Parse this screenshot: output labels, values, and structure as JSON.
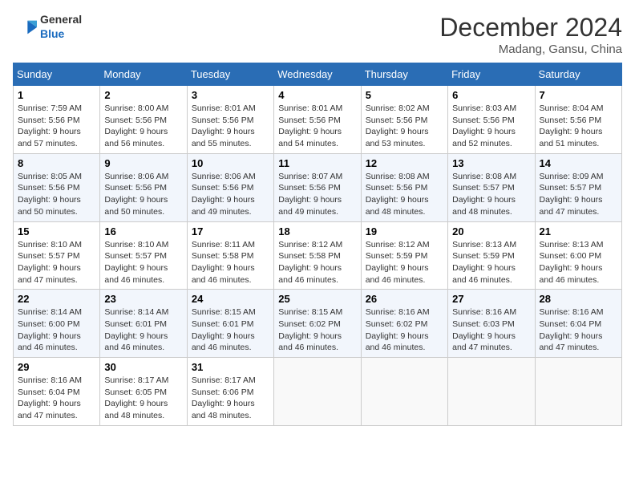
{
  "header": {
    "logo_general": "General",
    "logo_blue": "Blue",
    "title": "December 2024",
    "location": "Madang, Gansu, China"
  },
  "weekdays": [
    "Sunday",
    "Monday",
    "Tuesday",
    "Wednesday",
    "Thursday",
    "Friday",
    "Saturday"
  ],
  "weeks": [
    [
      {
        "day": "1",
        "sunrise": "7:59 AM",
        "sunset": "5:56 PM",
        "daylight": "9 hours and 57 minutes."
      },
      {
        "day": "2",
        "sunrise": "8:00 AM",
        "sunset": "5:56 PM",
        "daylight": "9 hours and 56 minutes."
      },
      {
        "day": "3",
        "sunrise": "8:01 AM",
        "sunset": "5:56 PM",
        "daylight": "9 hours and 55 minutes."
      },
      {
        "day": "4",
        "sunrise": "8:01 AM",
        "sunset": "5:56 PM",
        "daylight": "9 hours and 54 minutes."
      },
      {
        "day": "5",
        "sunrise": "8:02 AM",
        "sunset": "5:56 PM",
        "daylight": "9 hours and 53 minutes."
      },
      {
        "day": "6",
        "sunrise": "8:03 AM",
        "sunset": "5:56 PM",
        "daylight": "9 hours and 52 minutes."
      },
      {
        "day": "7",
        "sunrise": "8:04 AM",
        "sunset": "5:56 PM",
        "daylight": "9 hours and 51 minutes."
      }
    ],
    [
      {
        "day": "8",
        "sunrise": "8:05 AM",
        "sunset": "5:56 PM",
        "daylight": "9 hours and 50 minutes."
      },
      {
        "day": "9",
        "sunrise": "8:06 AM",
        "sunset": "5:56 PM",
        "daylight": "9 hours and 50 minutes."
      },
      {
        "day": "10",
        "sunrise": "8:06 AM",
        "sunset": "5:56 PM",
        "daylight": "9 hours and 49 minutes."
      },
      {
        "day": "11",
        "sunrise": "8:07 AM",
        "sunset": "5:56 PM",
        "daylight": "9 hours and 49 minutes."
      },
      {
        "day": "12",
        "sunrise": "8:08 AM",
        "sunset": "5:56 PM",
        "daylight": "9 hours and 48 minutes."
      },
      {
        "day": "13",
        "sunrise": "8:08 AM",
        "sunset": "5:57 PM",
        "daylight": "9 hours and 48 minutes."
      },
      {
        "day": "14",
        "sunrise": "8:09 AM",
        "sunset": "5:57 PM",
        "daylight": "9 hours and 47 minutes."
      }
    ],
    [
      {
        "day": "15",
        "sunrise": "8:10 AM",
        "sunset": "5:57 PM",
        "daylight": "9 hours and 47 minutes."
      },
      {
        "day": "16",
        "sunrise": "8:10 AM",
        "sunset": "5:57 PM",
        "daylight": "9 hours and 46 minutes."
      },
      {
        "day": "17",
        "sunrise": "8:11 AM",
        "sunset": "5:58 PM",
        "daylight": "9 hours and 46 minutes."
      },
      {
        "day": "18",
        "sunrise": "8:12 AM",
        "sunset": "5:58 PM",
        "daylight": "9 hours and 46 minutes."
      },
      {
        "day": "19",
        "sunrise": "8:12 AM",
        "sunset": "5:59 PM",
        "daylight": "9 hours and 46 minutes."
      },
      {
        "day": "20",
        "sunrise": "8:13 AM",
        "sunset": "5:59 PM",
        "daylight": "9 hours and 46 minutes."
      },
      {
        "day": "21",
        "sunrise": "8:13 AM",
        "sunset": "6:00 PM",
        "daylight": "9 hours and 46 minutes."
      }
    ],
    [
      {
        "day": "22",
        "sunrise": "8:14 AM",
        "sunset": "6:00 PM",
        "daylight": "9 hours and 46 minutes."
      },
      {
        "day": "23",
        "sunrise": "8:14 AM",
        "sunset": "6:01 PM",
        "daylight": "9 hours and 46 minutes."
      },
      {
        "day": "24",
        "sunrise": "8:15 AM",
        "sunset": "6:01 PM",
        "daylight": "9 hours and 46 minutes."
      },
      {
        "day": "25",
        "sunrise": "8:15 AM",
        "sunset": "6:02 PM",
        "daylight": "9 hours and 46 minutes."
      },
      {
        "day": "26",
        "sunrise": "8:16 AM",
        "sunset": "6:02 PM",
        "daylight": "9 hours and 46 minutes."
      },
      {
        "day": "27",
        "sunrise": "8:16 AM",
        "sunset": "6:03 PM",
        "daylight": "9 hours and 47 minutes."
      },
      {
        "day": "28",
        "sunrise": "8:16 AM",
        "sunset": "6:04 PM",
        "daylight": "9 hours and 47 minutes."
      }
    ],
    [
      {
        "day": "29",
        "sunrise": "8:16 AM",
        "sunset": "6:04 PM",
        "daylight": "9 hours and 47 minutes."
      },
      {
        "day": "30",
        "sunrise": "8:17 AM",
        "sunset": "6:05 PM",
        "daylight": "9 hours and 48 minutes."
      },
      {
        "day": "31",
        "sunrise": "8:17 AM",
        "sunset": "6:06 PM",
        "daylight": "9 hours and 48 minutes."
      },
      null,
      null,
      null,
      null
    ]
  ]
}
